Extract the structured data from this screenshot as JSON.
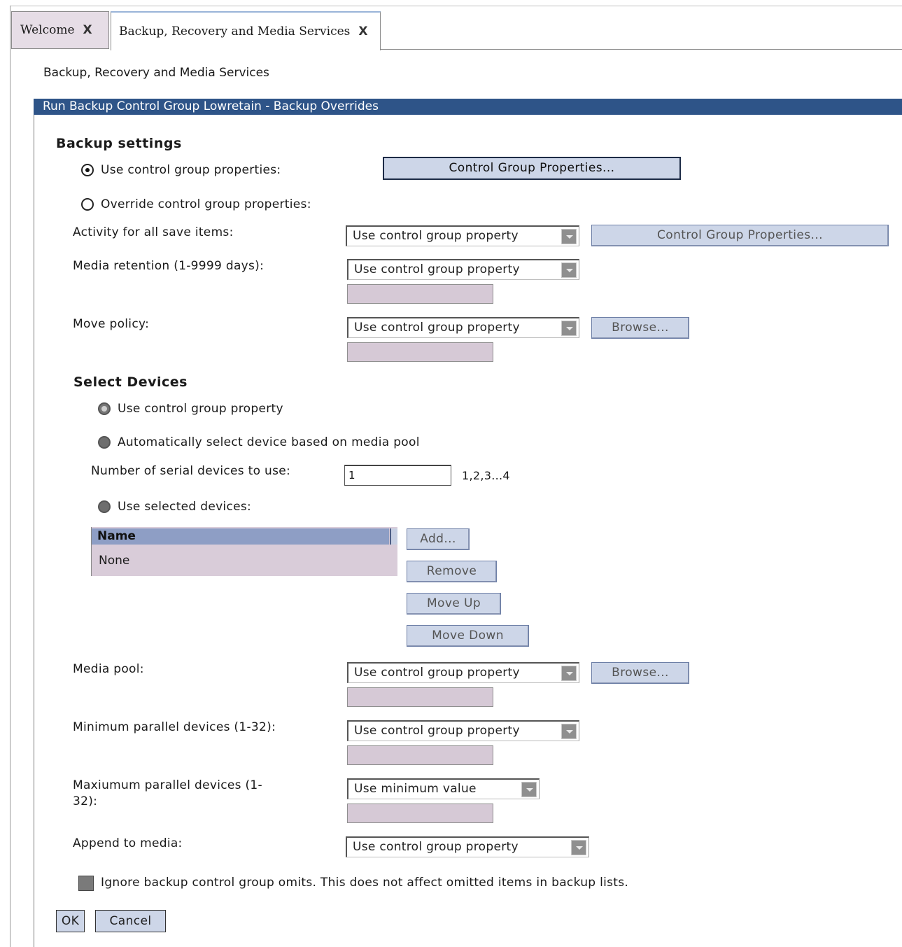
{
  "tabs": [
    {
      "label": "Welcome",
      "close": "X"
    },
    {
      "label": "Backup, Recovery and Media Services",
      "close": "X"
    }
  ],
  "breadcrumb": "Backup, Recovery and Media Services",
  "panel_title": "Run Backup Control Group Lowretain - Backup Overrides",
  "backup_settings": {
    "heading": "Backup settings",
    "use_cg_label": "Use control group properties:",
    "use_cg_button": "Control Group Properties...",
    "override_label": "Override control group properties:",
    "selected": "use_control_group_properties"
  },
  "activity": {
    "label": "Activity for all save items:",
    "value": "Use control group property",
    "button": "Control Group Properties..."
  },
  "media_retention": {
    "label": "Media retention (1-9999 days):",
    "value": "Use control group property"
  },
  "move_policy": {
    "label": "Move policy:",
    "value": "Use control group property",
    "button": "Browse..."
  },
  "select_devices": {
    "heading": "Select Devices",
    "opt_use_cg": "Use control group property",
    "opt_auto": "Automatically select device based on media pool",
    "serial_label": "Number of serial devices to use:",
    "serial_value": "1",
    "serial_hint": "1,2,3...4",
    "opt_selected": "Use selected devices:",
    "table_header": "Name",
    "table_rows": [
      "None"
    ],
    "buttons": {
      "add": "Add...",
      "remove": "Remove",
      "move_up": "Move Up",
      "move_down": "Move Down"
    }
  },
  "media_pool": {
    "label": "Media pool:",
    "value": "Use control group property",
    "button": "Browse..."
  },
  "min_parallel": {
    "label": "Minimum parallel devices (1-32):",
    "value": "Use control group property"
  },
  "max_parallel": {
    "label_line1": "Maxiumum parallel devices (1-",
    "label_line2": "32):",
    "value": "Use minimum value"
  },
  "append": {
    "label": "Append to media:",
    "value": "Use control group property"
  },
  "ignore_omits": {
    "label": "Ignore backup control group omits. This does not affect omitted items in backup lists.",
    "checked": false
  },
  "actions": {
    "ok": "OK",
    "cancel": "Cancel"
  }
}
